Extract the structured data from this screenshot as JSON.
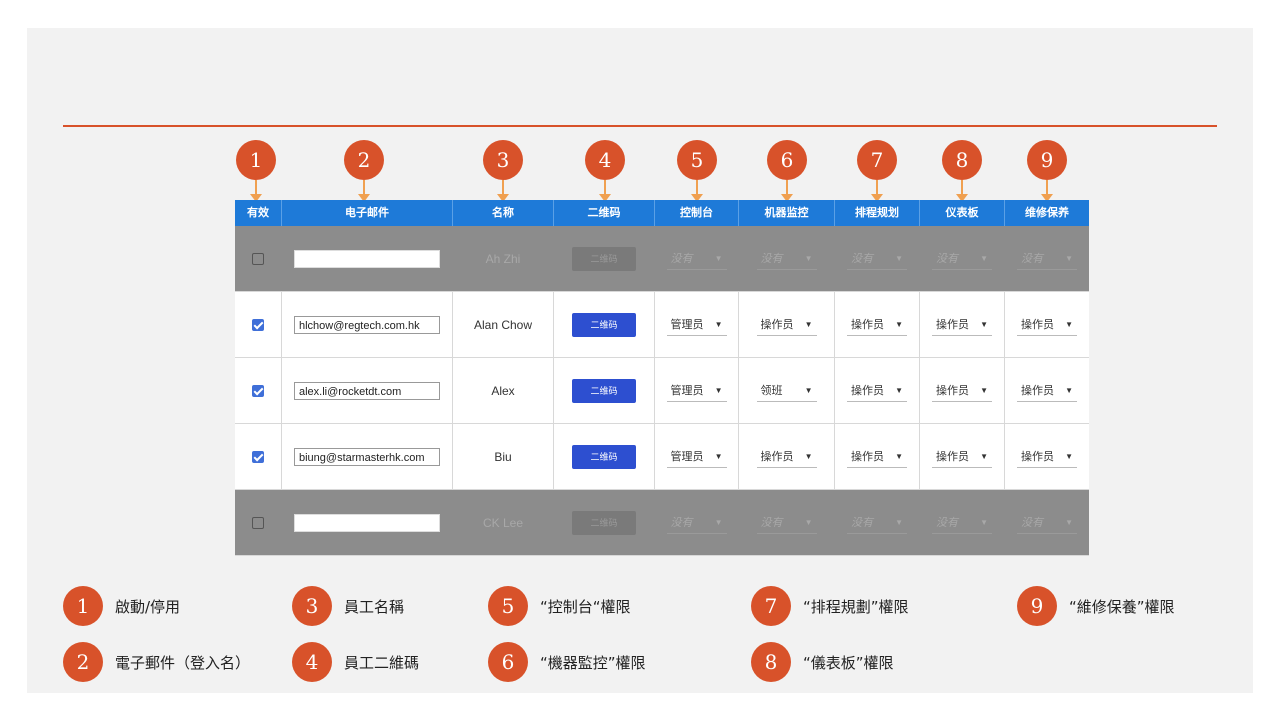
{
  "columns": [
    "有效",
    "电子邮件",
    "名称",
    "二维码",
    "控制台",
    "机器监控",
    "排程规划",
    "仪表板",
    "维修保养"
  ],
  "badges": [
    "1",
    "2",
    "3",
    "4",
    "5",
    "6",
    "7",
    "8",
    "9"
  ],
  "rows": [
    {
      "active": false,
      "email": "",
      "name": "Ah Zhi",
      "qr": "二维码",
      "roles": [
        "没有",
        "没有",
        "没有",
        "没有",
        "没有"
      ]
    },
    {
      "active": true,
      "email": "hlchow@regtech.com.hk",
      "name": "Alan Chow",
      "qr": "二维码",
      "roles": [
        "管理员",
        "操作员",
        "操作员",
        "操作员",
        "操作员"
      ]
    },
    {
      "active": true,
      "email": "alex.li@rocketdt.com",
      "name": "Alex",
      "qr": "二维码",
      "roles": [
        "管理员",
        "领班",
        "操作员",
        "操作员",
        "操作员"
      ]
    },
    {
      "active": true,
      "email": "biung@starmasterhk.com",
      "name": "Biu",
      "qr": "二维码",
      "roles": [
        "管理员",
        "操作员",
        "操作员",
        "操作员",
        "操作员"
      ]
    },
    {
      "active": false,
      "email": "",
      "name": "CK Lee",
      "qr": "二维码",
      "roles": [
        "没有",
        "没有",
        "没有",
        "没有",
        "没有"
      ]
    }
  ],
  "legend": [
    {
      "num": "1",
      "text": "啟動/停用"
    },
    {
      "num": "2",
      "text": "電子郵件（登入名）"
    },
    {
      "num": "3",
      "text": "員工名稱"
    },
    {
      "num": "4",
      "text": "員工二維碼"
    },
    {
      "num": "5",
      "text": "“控制台“權限"
    },
    {
      "num": "6",
      "text": "“機器監控”權限"
    },
    {
      "num": "7",
      "text": "“排程規劃”權限"
    },
    {
      "num": "8",
      "text": "“儀表板”權限"
    },
    {
      "num": "9",
      "text": "“維修保養”權限"
    }
  ],
  "colors": {
    "accent": "#d8522a",
    "header": "#1e7ad8",
    "qr_button": "#2d4fd0",
    "disabled_row": "#8c8c8c",
    "arrow": "#f0a050"
  }
}
